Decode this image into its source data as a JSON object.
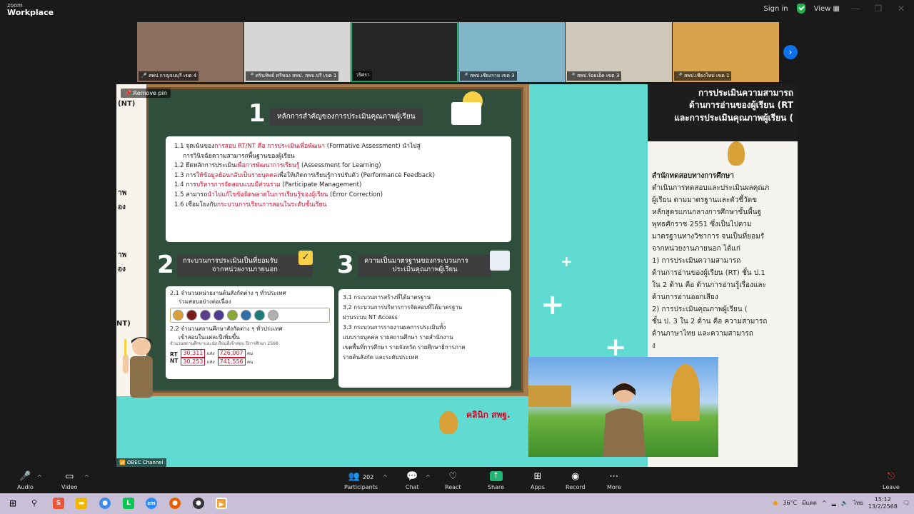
{
  "app": {
    "logo_line1": "zoom",
    "logo_line2": "Workplace"
  },
  "topbar": {
    "signin": "Sign in",
    "view": "View"
  },
  "thumbnails": [
    {
      "name": "สพป.กาญจนบุรี เขต 4",
      "muted": true,
      "bg": "#8a6e5e"
    },
    {
      "name": "ศรินทิพย์ ศรีทอง สพป. สพบ.ปรี เขต 1",
      "muted": true,
      "bg": "#d6d6d6"
    },
    {
      "name": "วริศรา",
      "muted": false,
      "bg": "#262626"
    },
    {
      "name": "สพป.เชียงราย เขต 3",
      "muted": true,
      "bg": "#7fb4c9"
    },
    {
      "name": "สพป.ร้อยเอ็ด เขต 3",
      "muted": true,
      "bg": "#cfc7b8"
    },
    {
      "name": "สพป.เชียงใหม่ เขต 1",
      "muted": true,
      "bg": "#d9a24d"
    }
  ],
  "pin": {
    "label": "Remove pin"
  },
  "slide": {
    "left_peek": [
      "(NT)",
      "าพ",
      "อง",
      "าพ",
      "อง"
    ],
    "left_peek2": "NT)",
    "sec1": {
      "num": "1",
      "title": "หลักการสำคัญของการประเมินคุณภาพผู้เรียน",
      "items": [
        [
          "1.1 จุดเน้นของ",
          "การสอบ RT/NT คือ การประเมินเพื่อพัฒนา",
          " (Formative Assessment) นำไปสู่"
        ],
        [
          "",
          "",
          "การวินิจฉัยความสามารถพื้นฐานของผู้เรียน"
        ],
        [
          "1.2 ยึดหลักการประเมิน",
          "เพื่อการพัฒนาการเรียนรู้",
          " (Assessment for Learning)"
        ],
        [
          "1.3 การ",
          "ให้ข้อมูลย้อนกลับเป็นรายบุคคล",
          "เพื่อให้เกิดการเรียนรู้การปรับตัว (Performance Feedback)"
        ],
        [
          "1.4 การ",
          "บริหารการจัดสอบแบบมีส่วนร่วม",
          " (Participate Management)"
        ],
        [
          "1.5 สามารถ",
          "นำไปแก้ไขข้อผิดพลาดในการเรียนรู้ของผู้เรียน",
          " (Error Correction)"
        ],
        [
          "1.6 เชื่อมโยงกับ",
          "กระบวนการเรียนการสอนในระดับชั้นเรียน",
          ""
        ]
      ]
    },
    "sec2": {
      "num": "2",
      "title_line1": "กระบวนการประเมินเป็นที่ยอมรับ",
      "title_line2": "จากหน่วยงานภายนอก",
      "item1_line1": "2.1 จำนวนหน่วยงานต้นสังกัดต่าง ๆ ทั่วประเทศ",
      "item1_line2": "ร่วมสอบอย่างต่อเนื่อง",
      "item2_line1": "2.2 จำนวนสถานศึกษาสังกัดต่าง ๆ ทั่วประเทศ",
      "item2_line2": "เข้าสอบในแต่ละปีเพิ่มขึ้น",
      "note": "จำนวนสถานศึกษาและนักเรียนที่เข้าสอบ ปีการศึกษา 2568",
      "rt_label": "RT",
      "nt_label": "NT",
      "rt_schools": "30,311",
      "nt_schools": "30,253",
      "rt_students": "726,007",
      "nt_students": "741,556",
      "unit_school": "แห่ง",
      "unit_person": "คน",
      "logo_colors": [
        "#d8a037",
        "#7a1b1b",
        "#5a3d8a",
        "#4e3b8c",
        "#8aa83a",
        "#2d6fa6",
        "#1a7a7a",
        "#b0b0b0"
      ]
    },
    "sec3": {
      "num": "3",
      "title_line1": "ความเป็นมาตรฐานของกระบวนการ",
      "title_line2": "ประเมินคุณภาพผู้เรียน",
      "lines": [
        "3.1 กระบวนการสร้างที่ได้มาตรฐาน",
        "3.2 กระบวนการบริหารการจัดสอบที่ได้มาตรฐาน",
        "ผ่านระบบ NT Access",
        "3.3 กระบวนการรายงานผลการประเมินทั้ง",
        "แบบรายบุคคล รายสถานศึกษา รายสำนักงาน",
        "เขตพื้นที่การศึกษา รายจังหวัด รายศึกษาธิการภาค",
        "รายต้นสังกัด และระดับประเทศ"
      ]
    },
    "clinic_logo": "คลินิก สพฐ.",
    "right": {
      "hdr_lines": [
        "การประเมินความสามารถ",
        "ด้านการอ่านของผู้เรียน (RT",
        "และการประเมินคุณภาพผู้เรียน ("
      ],
      "body_lines": [
        "    สำนักทดสอบทางการศึกษา",
        "ดำเนินการทดสอบและประเมินผลคุณภ",
        "ผู้เรียน ตามมาตรฐานและตัวชี้วัดข",
        "หลักสูตรแกนกลางการศึกษาขั้นพื้นฐ",
        "พุทธศักราช 2551 ซึ่งเป็นไปตาม",
        "มาตรฐานทางวิชาการ จนเป็นที่ยอมรั",
        "จากหน่วยงานภายนอก ได้แก่",
        "    1) การประเมินความสามารถ",
        "ด้านการอ่านของผู้เรียน (RT) ชั้น ป.1",
        "ใน 2 ด้าน คือ ด้านการอ่านรู้เรื่องและ",
        "ด้านการอ่านออกเสียง",
        "    2) การประเมินคุณภาพผู้เรียน (",
        "ชั้น ป. 3  ใน 2 ด้าน คือ ความสามารถ",
        "ด้านภาษาไทย และความสามารถ",
        "                                ง"
      ]
    }
  },
  "presenter": {
    "channel": "OBEC Channel"
  },
  "toolbar": {
    "audio": "Audio",
    "video": "Video",
    "participants": "Participants",
    "participants_count": "202",
    "chat": "Chat",
    "react": "React",
    "share": "Share",
    "apps": "Apps",
    "record": "Record",
    "more": "More",
    "leave": "Leave"
  },
  "taskbar": {
    "weather": "36°C",
    "weather_desc": "มีแดด",
    "lang": "ไทย",
    "time": "15:12",
    "date": "13/2/2568"
  }
}
